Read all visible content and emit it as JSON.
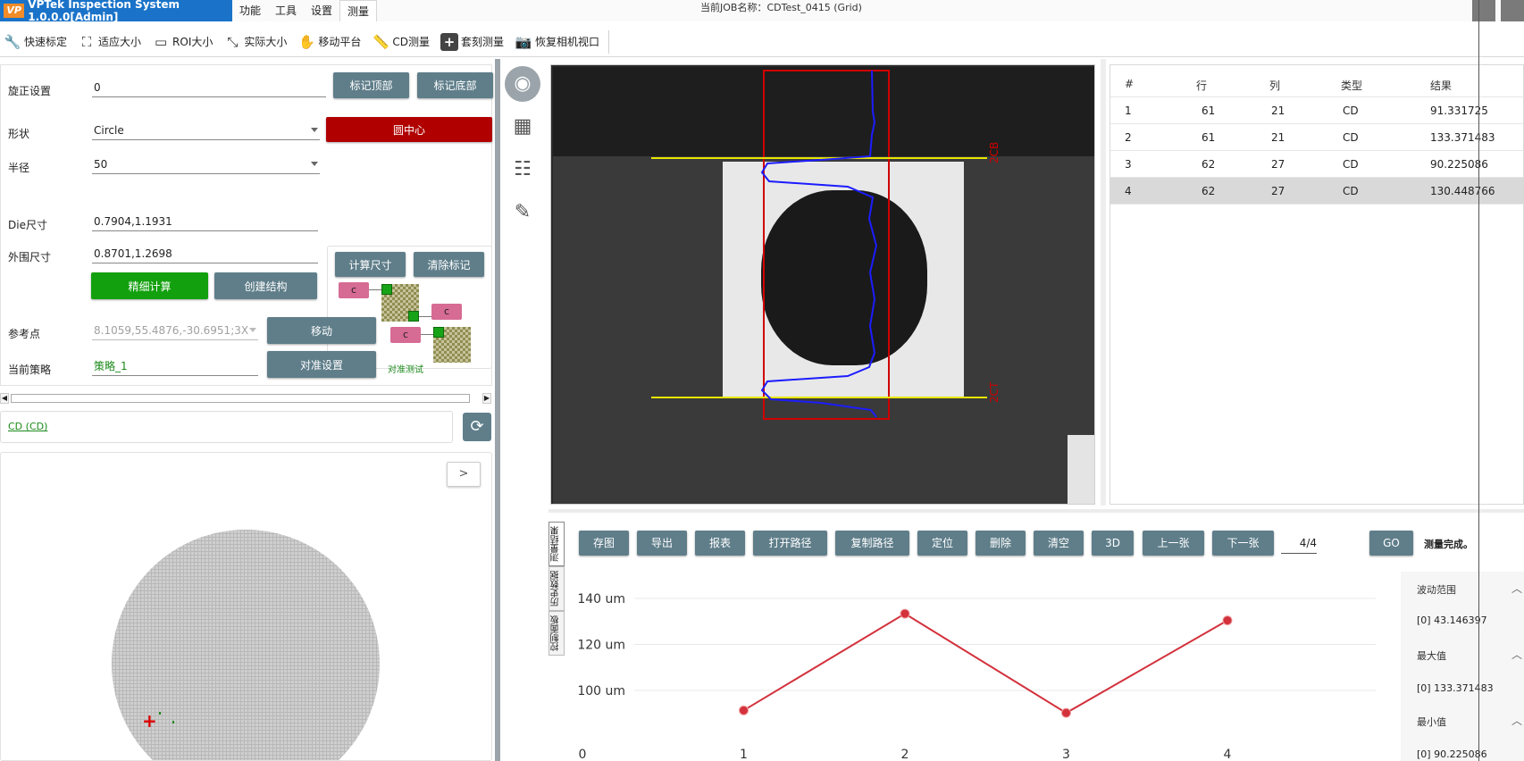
{
  "app": {
    "logo": "VP",
    "title": "VPTek Inspection System 1.0.0.0[Admin]",
    "menu": [
      "功能",
      "工具",
      "设置",
      "测量"
    ],
    "job_title": "当前JOB名称：CDTest_0415 (Grid)"
  },
  "toolbar": {
    "items": [
      {
        "label": "快速标定",
        "icon": "wrench-icon"
      },
      {
        "label": "适应大小",
        "icon": "fit-size-icon"
      },
      {
        "label": "ROI大小",
        "icon": "roi-size-icon"
      },
      {
        "label": "实际大小",
        "icon": "actual-size-icon"
      },
      {
        "label": "移动平台",
        "icon": "hand-move-icon"
      },
      {
        "label": "CD测量",
        "icon": "ruler-icon"
      },
      {
        "label": "套刻测量",
        "icon": "plus-icon"
      },
      {
        "label": "恢复相机视口",
        "icon": "camera-reset-icon"
      }
    ]
  },
  "settings": {
    "rotation_label": "旋正设置",
    "rotation_value": "0",
    "mark_top": "标记顶部",
    "mark_bottom": "标记底部",
    "shape_label": "形状",
    "shape_value": "Circle",
    "circle_center": "圆中心",
    "radius_label": "半径",
    "radius_value": "50",
    "calc_size": "计算尺寸",
    "clear_marks": "清除标记",
    "die_label": "Die尺寸",
    "die_value": "0.7904,1.1931",
    "outer_label": "外围尺寸",
    "outer_value": "0.8701,1.2698",
    "fine_calc": "精细计算",
    "create_struct": "创建结构",
    "ref_label": "参考点",
    "ref_value": "8.1059,55.4876,-30.6951;3X",
    "move": "移动",
    "strategy_label": "当前策略",
    "strategy_value": "策略_1",
    "align_settings": "对准设置",
    "align_test": "对准测试",
    "tag_c": "c"
  },
  "cd_item": "CD (CD)",
  "wafer": {
    "next": ">"
  },
  "results": {
    "headers": [
      "#",
      "行",
      "列",
      "类型",
      "结果"
    ],
    "rows": [
      [
        "1",
        "61",
        "21",
        "CD",
        "91.331725"
      ],
      [
        "2",
        "61",
        "21",
        "CD",
        "133.371483"
      ],
      [
        "3",
        "62",
        "27",
        "CD",
        "90.225086"
      ],
      [
        "4",
        "62",
        "27",
        "CD",
        "130.448766"
      ]
    ],
    "selected_index": 3
  },
  "image": {
    "label_top": "2CB",
    "label_bottom": "2CT"
  },
  "bottom": {
    "tabs": [
      "测量结果",
      "历史数据",
      "控制面板"
    ],
    "buttons": [
      "存图",
      "导出",
      "报表",
      "打开路径",
      "复制路径",
      "定位",
      "删除",
      "清空",
      "3D",
      "上一张",
      "下一张"
    ],
    "page": "4/4",
    "go": "GO",
    "status": "测量完成。"
  },
  "chart_data": {
    "type": "line",
    "x": [
      1,
      2,
      3,
      4
    ],
    "values": [
      91.331725,
      133.371483,
      90.225086,
      130.448766
    ],
    "y_ticks": [
      "100 um",
      "120 um",
      "140 um"
    ],
    "x_ticks": [
      "0",
      "1",
      "2",
      "3",
      "4"
    ],
    "ylim": [
      80,
      145
    ],
    "xlim": [
      0,
      4
    ],
    "line_color": "#d3313c"
  },
  "stats": {
    "range_label": "波动范围",
    "range_value": "[0]  43.146397",
    "max_label": "最大值",
    "max_value": "[0]  133.371483",
    "min_label": "最小值",
    "min_value": "[0]  90.225086"
  }
}
